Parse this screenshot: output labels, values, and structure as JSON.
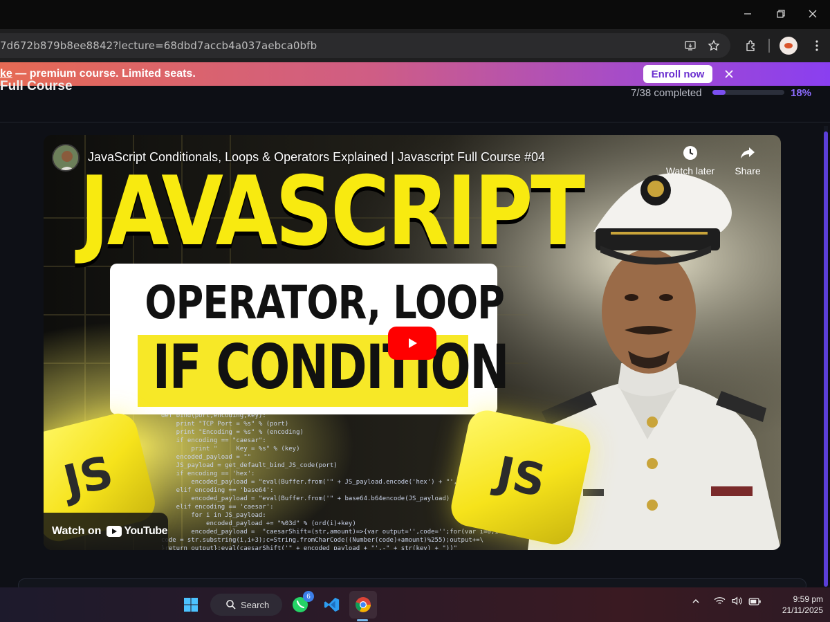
{
  "window": {
    "minimize_icon": "minimize-icon",
    "restore_icon": "restore-icon",
    "close_icon": "close-icon"
  },
  "browser": {
    "url": "7d672b879b8ee8842?lecture=68dbd7accb4a037aebca0bfb",
    "icons": [
      "install-app-icon",
      "bookmark-star-icon",
      "extensions-icon",
      "profile-avatar",
      "more-menu-icon"
    ]
  },
  "promo": {
    "lead_text": "ke",
    "text": " — premium course. Limited seats.",
    "enroll_label": "Enroll now",
    "gradient": [
      "#e66a54",
      "#cf5d85",
      "#a64cc8",
      "#8a3ff0"
    ]
  },
  "course": {
    "title": "Full Course",
    "completed_text": "7/38 completed",
    "progress_fraction": 0.18,
    "percent_text": "18%",
    "accent": "#7b4ff0"
  },
  "video": {
    "title": "JavaScript Conditionals, Loops & Operators Explained | Javascript Full Course #04",
    "watch_later": "Watch later",
    "share": "Share",
    "watch_on": "Watch on",
    "youtube": "YouTube",
    "thumb_big": "JAVASCRIPT",
    "thumb_line1": "OPERATOR, LOOP",
    "thumb_line2": "IF CONDITION",
    "cube_label": "JS",
    "code_lines": [
      "def bind(port,encoding,key):",
      "    print \"TCP Port = %s\" % (port)",
      "    print \"Encoding = %s\" % (encoding)",
      "    if encoding == \"caesar\":",
      "        print \"     Key = %s\" % (key)",
      "    encoded_payload = \"\"",
      "    JS_payload = get_default_bind_JS_code(port)",
      "    if encoding == 'hex':",
      "        encoded_payload = \"eval(Buffer.from('\" + JS_payload.encode('hex') + \"','hex').toS",
      "    elif encoding == 'base64':",
      "        encoded_payload = \"eval(Buffer.from('\" + base64.b64encode(JS_payload) + \"','base",
      "    elif encoding == 'caesar':",
      "        for i in JS_payload:",
      "            encoded_payload += \"%03d\" % (ord(i)+key)",
      "        encoded_payload =  \"caesarShift=(str,amount)=>{var output='',code='';for(var i=0;i<str.length",
      "code = str.substring(i,i+3);c=String.fromCharCode((Number(code)+amount)%255);output+=\\",
      "}return output};eval(caesarShift('\" + encoded_payload + \"',-\" + str(key) + \"))\""
    ]
  },
  "taskbar": {
    "search_label": "Search",
    "whatsapp_badge": "6",
    "time": "9:59 pm",
    "date": "21/11/2025"
  }
}
